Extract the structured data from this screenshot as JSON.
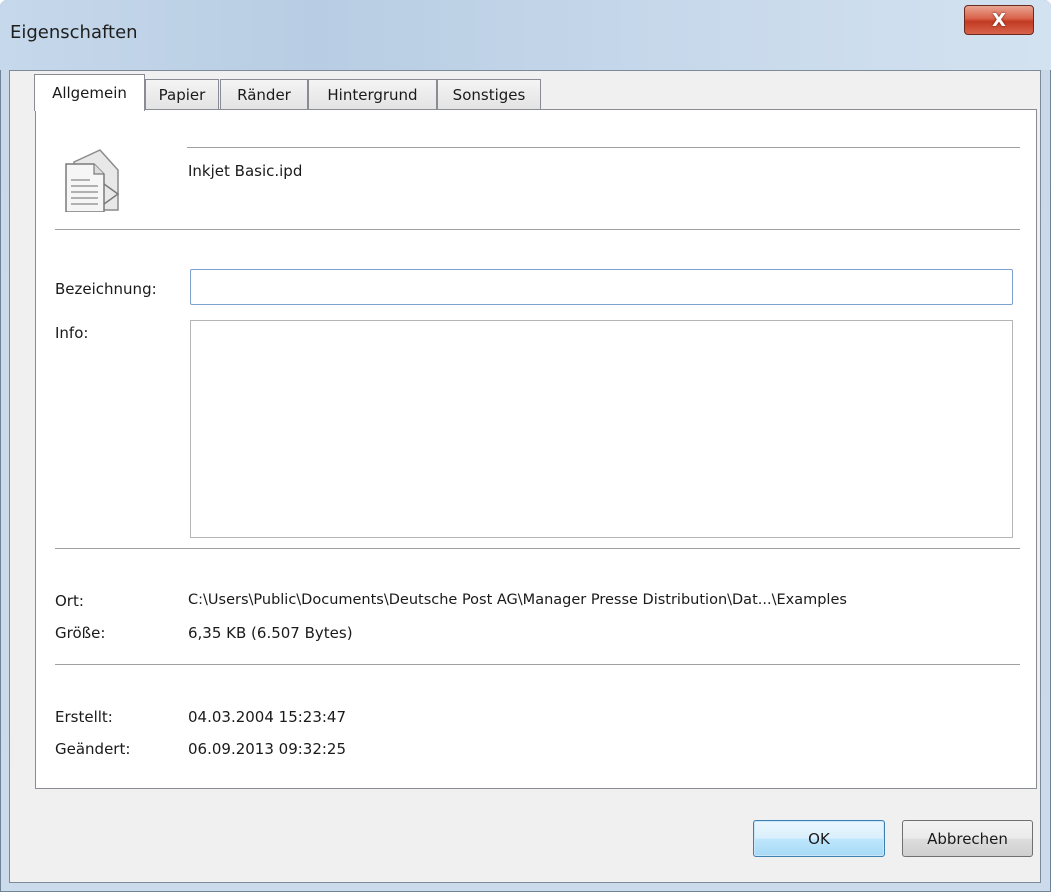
{
  "window": {
    "title": "Eigenschaften",
    "close_label": "X"
  },
  "tabs": [
    {
      "label": "Allgemein",
      "active": true
    },
    {
      "label": "Papier",
      "active": false
    },
    {
      "label": "Ränder",
      "active": false
    },
    {
      "label": "Hintergrund",
      "active": false
    },
    {
      "label": "Sonstiges",
      "active": false
    }
  ],
  "file": {
    "name": "Inkjet Basic.ipd",
    "icon": "document-icon"
  },
  "fields": {
    "bezeichnung_label": "Bezeichnung:",
    "bezeichnung_value": "",
    "info_label": "Info:",
    "info_value": ""
  },
  "details": {
    "ort_label": "Ort:",
    "ort_value": "C:\\Users\\Public\\Documents\\Deutsche Post AG\\Manager Presse Distribution\\Dat...\\Examples",
    "groesse_label": "Größe:",
    "groesse_value": "6,35 KB (6.507 Bytes)",
    "erstellt_label": "Erstellt:",
    "erstellt_value": "04.03.2004 15:23:47",
    "geaendert_label": "Geändert:",
    "geaendert_value": "06.09.2013 09:32:25"
  },
  "buttons": {
    "ok": "OK",
    "cancel": "Abbrechen"
  }
}
